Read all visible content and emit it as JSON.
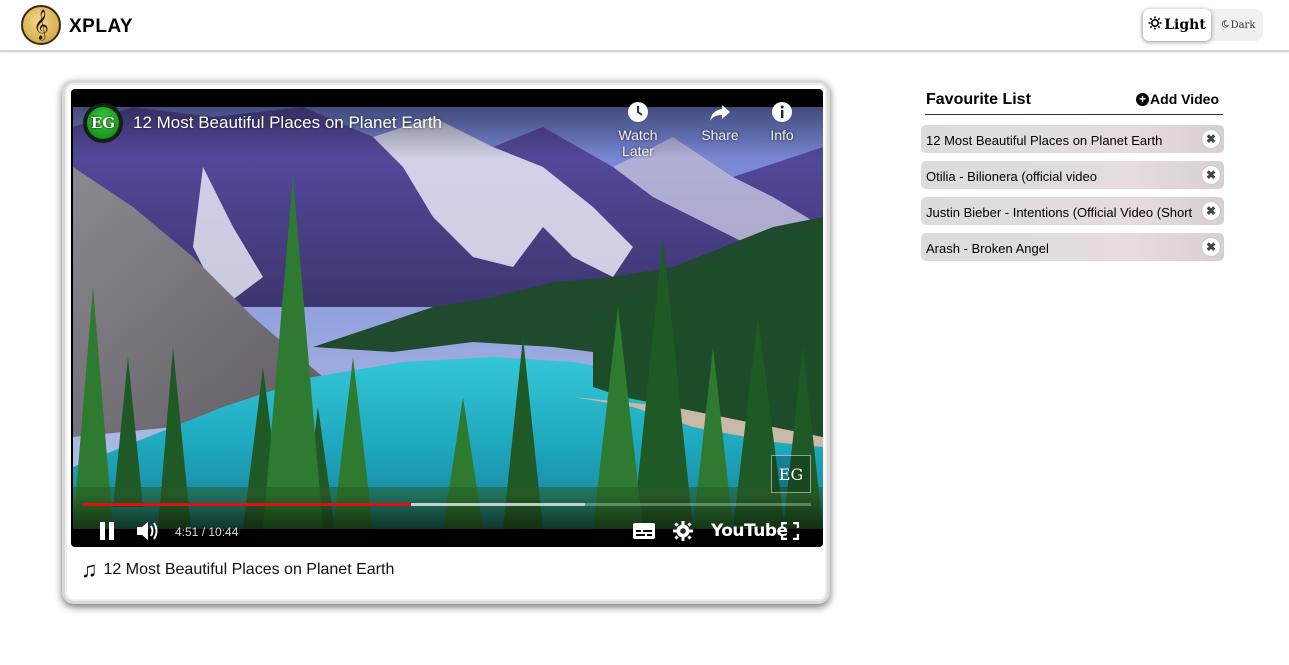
{
  "header": {
    "brand": "XPLAY",
    "theme_light_label": "Light",
    "theme_dark_label": "Dark",
    "active_theme": "Light"
  },
  "player": {
    "video_title": "12 Most Beautiful Places on Planet Earth",
    "channel_logo_text": "EG",
    "watermark_text": "EG",
    "actions": [
      {
        "label": "Watch Later",
        "icon": "clock-icon"
      },
      {
        "label": "Share",
        "icon": "share-icon"
      },
      {
        "label": "Info",
        "icon": "info-icon"
      }
    ],
    "time_display": "4:51 / 10:44",
    "progress_played": 0.45,
    "progress_buffered": 0.69,
    "youtube_label": "YouTube",
    "caption": "12 Most Beautiful Places on Planet Earth"
  },
  "favourites": {
    "title": "Favourite List",
    "add_label": "Add Video",
    "items": [
      {
        "label": "12 Most Beautiful Places on Planet Earth"
      },
      {
        "label": "Otilia - Bilionera (official video"
      },
      {
        "label": "Justin Bieber - Intentions (Official Video (Short"
      },
      {
        "label": "Arash - Broken Angel"
      }
    ]
  },
  "colors": {
    "progress_played": "#e01010",
    "lake": "#1fb3c6",
    "header_border": "#d6d6d6"
  }
}
